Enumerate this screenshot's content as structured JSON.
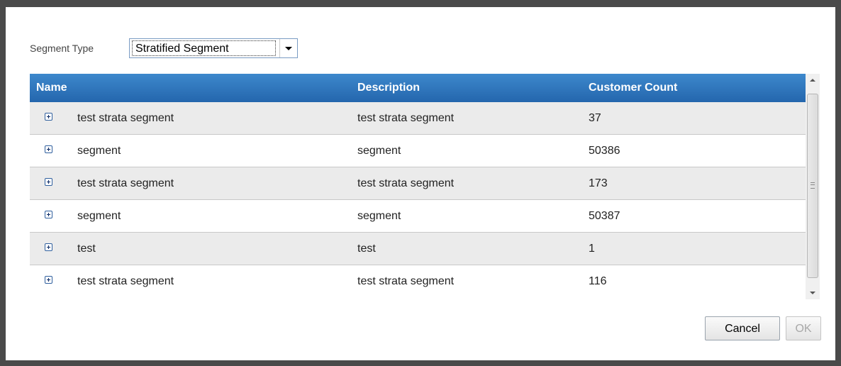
{
  "segment_type": {
    "label": "Segment Type",
    "selected": "Stratified Segment"
  },
  "table": {
    "columns": [
      "Name",
      "Description",
      "Customer Count"
    ],
    "rows": [
      {
        "name": "test strata segment",
        "description": "test strata segment",
        "count": "37"
      },
      {
        "name": "segment",
        "description": "segment",
        "count": "50386"
      },
      {
        "name": "test strata segment",
        "description": "test strata segment",
        "count": "173"
      },
      {
        "name": "segment",
        "description": "segment",
        "count": "50387"
      },
      {
        "name": "test",
        "description": "test",
        "count": "1"
      },
      {
        "name": "test strata segment",
        "description": "test strata segment",
        "count": "116"
      }
    ]
  },
  "buttons": {
    "cancel": "Cancel",
    "ok": "OK"
  },
  "colors": {
    "header": "#2f77bf",
    "row_alt": "#ebebeb",
    "backdrop": "#4a4a4a"
  },
  "icons": {
    "expand": "plus-box-icon",
    "dropdown": "chevron-down-icon",
    "scroll_up": "arrow-up-icon",
    "scroll_down": "arrow-down-icon"
  }
}
